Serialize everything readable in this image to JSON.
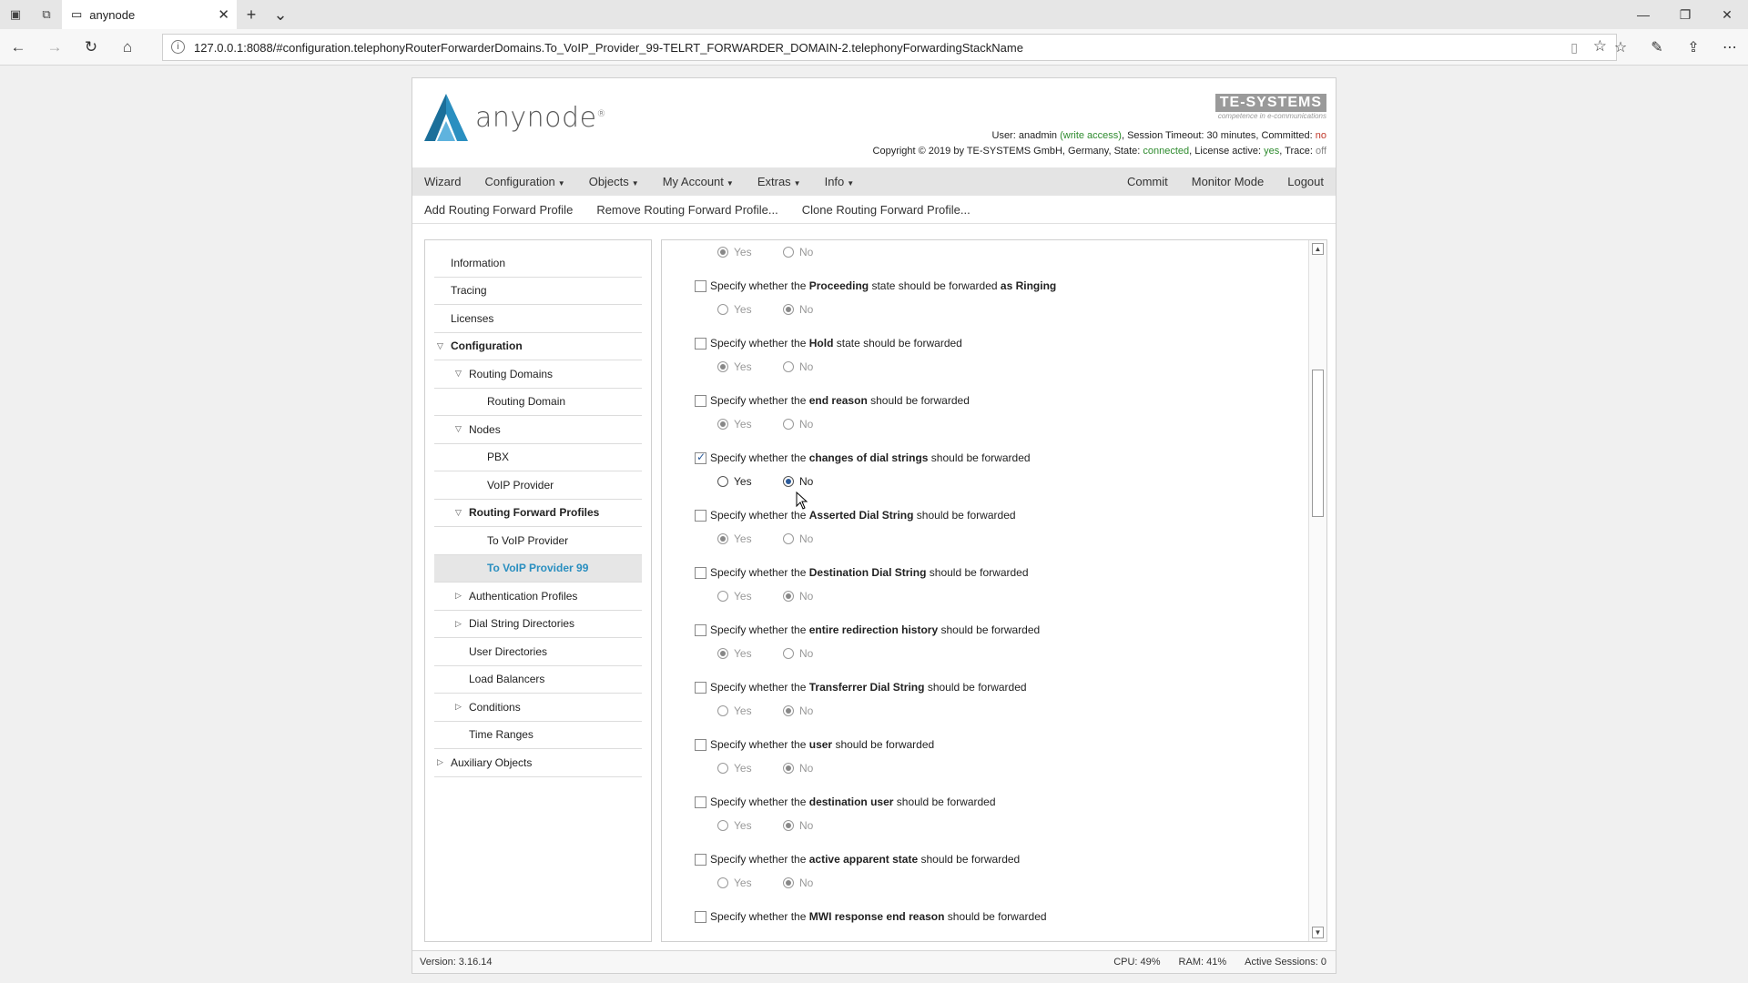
{
  "browser": {
    "tab_title": "anynode",
    "url": "127.0.0.1:8088/#configuration.telephonyRouterForwarderDomains.To_VoIP_Provider_99-TELRT_FORWARDER_DOMAIN-2.telephonyForwardingStackName"
  },
  "header": {
    "product_name": "anynode",
    "company_logo": "TE-SYSTEMS",
    "company_tagline": "competence in e-communications",
    "user_label": "User:",
    "user": "anadmin",
    "access": "(write access)",
    "timeout_label": ", Session Timeout:",
    "timeout": "30 minutes",
    "committed_label": ", Committed:",
    "committed": "no",
    "copyright": "Copyright © 2019 by TE-SYSTEMS GmbH, Germany, State:",
    "state": "connected",
    "license_label": ", License active:",
    "license": "yes",
    "trace_label": ", Trace:",
    "trace": "off"
  },
  "menu": {
    "wizard": "Wizard",
    "configuration": "Configuration",
    "objects": "Objects",
    "my_account": "My Account",
    "extras": "Extras",
    "info": "Info",
    "commit": "Commit",
    "monitor_mode": "Monitor Mode",
    "logout": "Logout"
  },
  "toolbar": {
    "add": "Add Routing Forward Profile",
    "remove": "Remove Routing Forward Profile...",
    "clone": "Clone Routing Forward Profile..."
  },
  "sidebar": {
    "information": "Information",
    "tracing": "Tracing",
    "licenses": "Licenses",
    "configuration": "Configuration",
    "routing_domains": "Routing Domains",
    "routing_domain": "Routing Domain",
    "nodes": "Nodes",
    "pbx": "PBX",
    "voip_provider": "VoIP Provider",
    "routing_forward_profiles": "Routing Forward Profiles",
    "to_voip_provider": "To VoIP Provider",
    "to_voip_provider_99": "To VoIP Provider 99",
    "authentication_profiles": "Authentication Profiles",
    "dial_string_directories": "Dial String Directories",
    "user_directories": "User Directories",
    "load_balancers": "Load Balancers",
    "conditions": "Conditions",
    "time_ranges": "Time Ranges",
    "auxiliary_objects": "Auxiliary Objects"
  },
  "options": {
    "prefix": "Specify whether the",
    "suffix": "should be forwarded",
    "yes": "Yes",
    "no": "No",
    "proceeding_term": "Proceeding",
    "proceeding_mid": "state should be forwarded",
    "proceeding_end": "as Ringing",
    "hold_term": "Hold",
    "hold_suffix": "state should be forwarded",
    "end_reason": "end reason",
    "dial_string_changes": "changes of dial strings",
    "asserted_dial_string": "Asserted Dial String",
    "destination_dial_string": "Destination Dial String",
    "redirection_history": "entire redirection history",
    "transferrer_dial_string": "Transferrer Dial String",
    "user": "user",
    "destination_user": "destination user",
    "active_apparent_state": "active apparent state",
    "mwi_end_reason": "MWI response end reason"
  },
  "footer": {
    "version": "Version: 3.16.14",
    "cpu": "CPU: 49%",
    "ram": "RAM: 41%",
    "sessions": "Active Sessions: 0"
  }
}
